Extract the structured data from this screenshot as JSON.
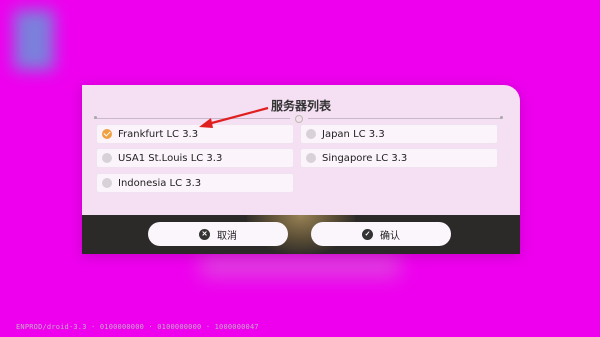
{
  "dialog": {
    "title": "服务器列表",
    "servers": [
      {
        "label": "Frankfurt LC 3.3",
        "selected": true
      },
      {
        "label": "Japan LC 3.3",
        "selected": false
      },
      {
        "label": "USA1 St.Louis LC 3.3",
        "selected": false
      },
      {
        "label": "Singapore LC 3.3",
        "selected": false
      },
      {
        "label": "Indonesia LC 3.3",
        "selected": false
      }
    ],
    "cancel_label": "取消",
    "confirm_label": "确认",
    "cancel_icon": "x-circle-icon",
    "confirm_icon": "check-circle-icon"
  },
  "version_text": "ENPROD/droid-3.3 · 0100000000 · 0100000000 · 1000000047",
  "colors": {
    "background": "#ee00ee",
    "dialog_bg": "#f4dff3",
    "footer_bg": "#2c2a28",
    "selected_radio": "#f0a040",
    "annotation_arrow": "#e02020"
  }
}
